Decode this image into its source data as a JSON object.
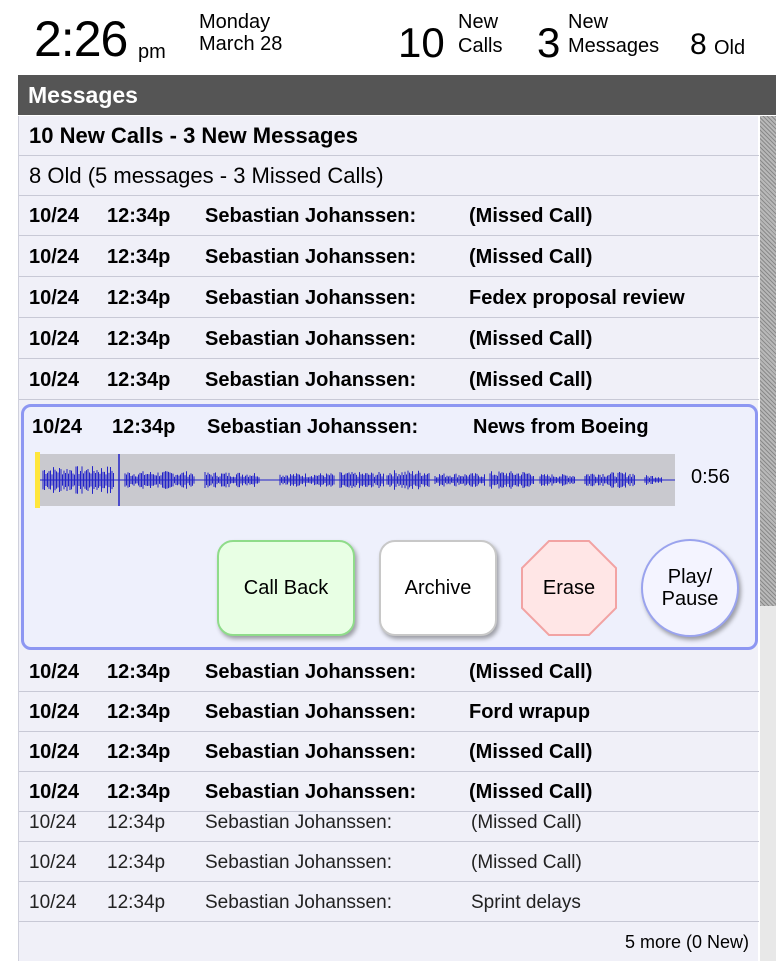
{
  "status": {
    "time": "2:26",
    "ampm": "pm",
    "day": "Monday",
    "date": "March 28",
    "new_calls_count": "10",
    "new_calls_label_1": "New",
    "new_calls_label_2": "Calls",
    "new_messages_count": "3",
    "new_messages_label_1": "New",
    "new_messages_label_2": "Messages",
    "old_count": "8",
    "old_label": "Old"
  },
  "panel": {
    "title": "Messages",
    "summary_new": "10 New Calls - 3 New Messages",
    "summary_old": "8 Old (5 messages - 3 Missed Calls)",
    "more": "5 more (0 New)"
  },
  "messages_before": [
    {
      "date": "10/24",
      "time": "12:34p",
      "name": "Sebastian Johanssen:",
      "subject": "(Missed Call)"
    },
    {
      "date": "10/24",
      "time": "12:34p",
      "name": "Sebastian Johanssen:",
      "subject": "(Missed Call)"
    },
    {
      "date": "10/24",
      "time": "12:34p",
      "name": "Sebastian Johanssen:",
      "subject": "Fedex proposal review"
    },
    {
      "date": "10/24",
      "time": "12:34p",
      "name": "Sebastian Johanssen:",
      "subject": "(Missed Call)"
    },
    {
      "date": "10/24",
      "time": "12:34p",
      "name": "Sebastian Johanssen:",
      "subject": "(Missed Call)"
    }
  ],
  "selected": {
    "date": "10/24",
    "time": "12:34p",
    "name": "Sebastian Johanssen:",
    "subject": "News from Boeing",
    "duration": "0:56",
    "playback_position": 0.0,
    "buttons": {
      "call_back": "Call Back",
      "archive": "Archive",
      "erase": "Erase",
      "play_line1": "Play/",
      "play_line2": "Pause"
    }
  },
  "messages_after": [
    {
      "date": "10/24",
      "time": "12:34p",
      "name": "Sebastian Johanssen:",
      "subject": "(Missed Call)",
      "read": false
    },
    {
      "date": "10/24",
      "time": "12:34p",
      "name": "Sebastian Johanssen:",
      "subject": "Ford wrapup",
      "read": false
    },
    {
      "date": "10/24",
      "time": "12:34p",
      "name": "Sebastian Johanssen:",
      "subject": "(Missed Call)",
      "read": false
    },
    {
      "date": "10/24",
      "time": "12:34p",
      "name": "Sebastian Johanssen:",
      "subject": "(Missed Call)",
      "read": false
    },
    {
      "date": "10/24",
      "time": "12:34p",
      "name": "Sebastian Johanssen:",
      "subject": "(Missed Call)",
      "read": true
    },
    {
      "date": "10/24",
      "time": "12:34p",
      "name": "Sebastian Johanssen:",
      "subject": "(Missed Call)",
      "read": true
    },
    {
      "date": "10/24",
      "time": "12:34p",
      "name": "Sebastian Johanssen:",
      "subject": "Sprint delays",
      "read": true
    }
  ],
  "colors": {
    "waveform": "#2323c8",
    "selection_border": "#8d97f2",
    "call_back": "#e8ffe4",
    "erase": "#ffe6e6",
    "title_bar": "#555555"
  }
}
